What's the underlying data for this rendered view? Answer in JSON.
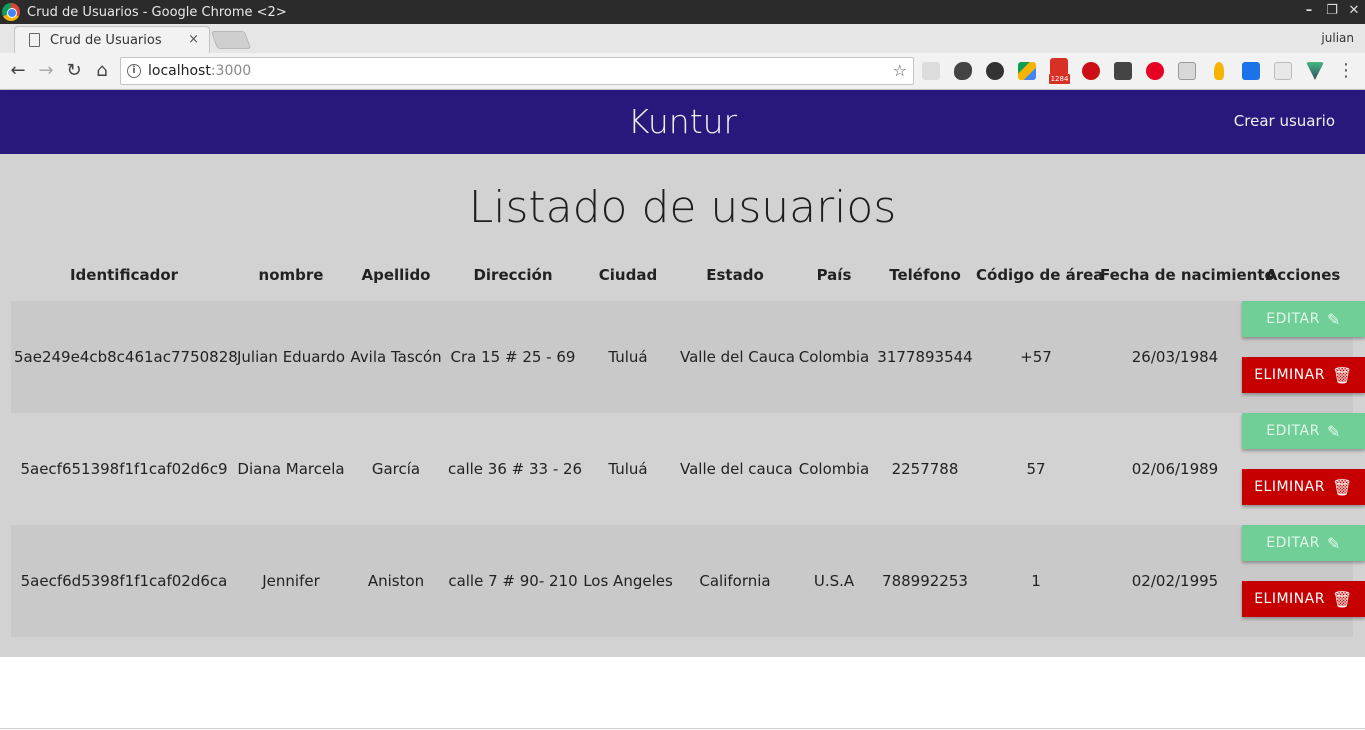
{
  "window": {
    "title": "Crud de Usuarios - Google Chrome <2>",
    "controls": [
      "–",
      "❐",
      "✕"
    ]
  },
  "tab": {
    "title": "Crud de Usuarios",
    "close": "×"
  },
  "profile": {
    "name": "julian"
  },
  "toolbar": {
    "back": "←",
    "forward": "→",
    "reload": "↻",
    "home": "⌂",
    "star": "☆",
    "menu": "⋮"
  },
  "address": {
    "host": "localhost",
    "port": ":3000"
  },
  "extensions": {
    "gmail_badge": "1284"
  },
  "app": {
    "brand": "Kuntur",
    "create_link": "Crear usuario",
    "page_title": "Listado de usuarios",
    "bar_color": "#28187c"
  },
  "table": {
    "headers": [
      "Identificador",
      "nombre",
      "Apellido",
      "Dirección",
      "Ciudad",
      "Estado",
      "País",
      "Teléfono",
      "Código de área",
      "Fecha de nacimiento",
      "Acciones"
    ],
    "rows": [
      [
        "5ae249e4cb8c461ac7750828",
        "Julian Eduardo",
        "Avila Tascón",
        "Cra 15 # 25 - 69",
        "Tuluá",
        "Valle del Cauca",
        "Colombia",
        "3177893544",
        "+57",
        "26/03/1984"
      ],
      [
        "5aecf651398f1f1caf02d6c9",
        "Diana Marcela",
        "García",
        "calle 36 # 33 - 26",
        "Tuluá",
        "Valle del cauca",
        "Colombia",
        "2257788",
        "57",
        "02/06/1989"
      ],
      [
        "5aecf6d5398f1f1caf02d6ca",
        "Jennifer",
        "Aniston",
        "calle 7 # 90- 210",
        "Los Angeles",
        "California",
        "U.S.A",
        "788992253",
        "1",
        "02/02/1995"
      ]
    ],
    "actions": {
      "edit": "EDITAR",
      "delete": "ELIMINAR",
      "edit_icon": "✎",
      "delete_icon": "🗑"
    },
    "colors": {
      "edit": "#6fcf97",
      "delete": "#c60000"
    }
  }
}
